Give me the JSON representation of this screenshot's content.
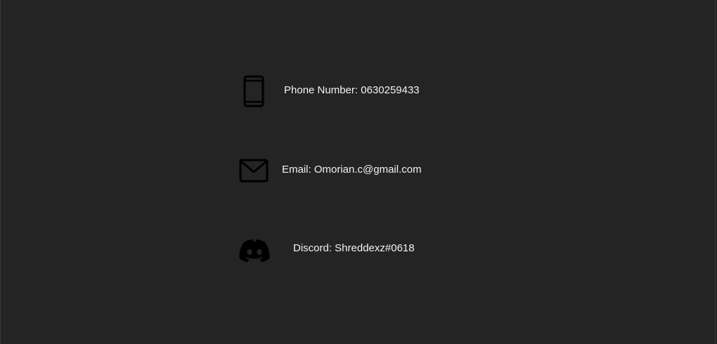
{
  "contacts": {
    "phone": {
      "icon": "phone-icon",
      "label": "Phone Number: 0630259433"
    },
    "email": {
      "icon": "mail-icon",
      "label": "Email: Omorian.c@gmail.com"
    },
    "discord": {
      "icon": "discord-icon",
      "label": "Discord: Shreddexz#0618"
    }
  },
  "colors": {
    "background": "#242424",
    "text": "#f2f2f2",
    "icon": "#000000"
  }
}
